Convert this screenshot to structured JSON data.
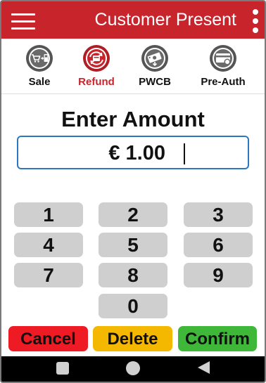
{
  "header": {
    "title": "Customer Present"
  },
  "tabs": [
    {
      "label": "Sale",
      "icon": "cart-to-card-icon"
    },
    {
      "label": "Refund",
      "icon": "refund-arrows-icon"
    },
    {
      "label": "PWCB",
      "icon": "cash-back-icon"
    },
    {
      "label": "Pre-Auth",
      "icon": "card-lock-icon"
    }
  ],
  "active_tab": "Refund",
  "amount": {
    "title": "Enter Amount",
    "value": "€ 1.00"
  },
  "keypad": [
    "1",
    "2",
    "3",
    "4",
    "5",
    "6",
    "7",
    "8",
    "9",
    "0"
  ],
  "actions": {
    "cancel": "Cancel",
    "delete": "Delete",
    "confirm": "Confirm"
  },
  "colors": {
    "brand": "#c8242c",
    "input_border": "#2b78c2",
    "key_bg": "#cfcfcf",
    "cancel": "#ee1b24",
    "delete": "#f5b800",
    "confirm": "#3fb83a"
  }
}
